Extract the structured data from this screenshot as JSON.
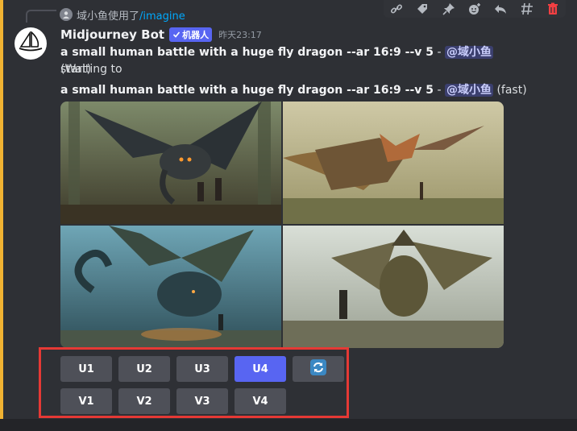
{
  "reply": {
    "user": "域小鱼",
    "action": "使用了",
    "command": "/imagine"
  },
  "bot": {
    "name": "Midjourney Bot",
    "tag": "机器人",
    "time": "昨天23:17"
  },
  "message1": {
    "prompt": "a small human battle with a huge fly dragon --ar 16:9 --v 5",
    "separator": " - ",
    "mention": "@域小鱼",
    "status": "(Waiting to",
    "status2": "start)"
  },
  "message2": {
    "prompt": "a small human battle with a huge fly dragon --ar 16:9 --v 5",
    "separator": " - ",
    "mention": "@域小鱼",
    "status": "(fast)"
  },
  "buttons": {
    "upscale": [
      "U1",
      "U2",
      "U3",
      "U4"
    ],
    "variation": [
      "V1",
      "V2",
      "V3",
      "V4"
    ],
    "active": "U4"
  },
  "colors": {
    "accent": "#5865f2",
    "highlight": "#e53935",
    "mention_bg": "#3c4270"
  },
  "icons": [
    "link-icon",
    "tag-icon",
    "pin-icon",
    "add-reaction-icon",
    "reply-icon",
    "thread-icon",
    "delete-icon",
    "refresh-icon",
    "midjourney-sailboat-icon"
  ]
}
